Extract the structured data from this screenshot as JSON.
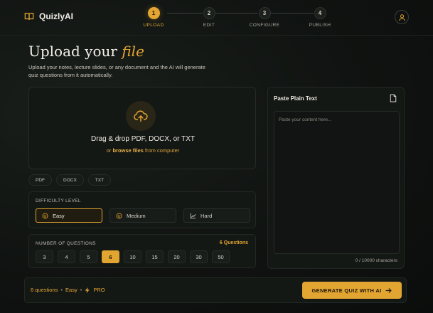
{
  "app": {
    "name": "QuizlyAI"
  },
  "stepper": {
    "steps": [
      {
        "number": "1",
        "label": "UPLOAD"
      },
      {
        "number": "2",
        "label": "EDIT"
      },
      {
        "number": "3",
        "label": "CONFIGURE"
      },
      {
        "number": "4",
        "label": "PUBLISH"
      }
    ],
    "active_index": 0
  },
  "page": {
    "title_prefix": "Upload your",
    "title_highlight": "file",
    "subtitle": "Upload your notes, lecture slides, or any document and the AI will generate quiz questions from it automatically."
  },
  "dropzone": {
    "icon": "cloud-upload-icon",
    "title": "Drag & drop PDF, DOCX, or TXT",
    "sub_prefix": "or",
    "link": "browse files",
    "sub_suffix": "from computer"
  },
  "file_types": [
    "PDF",
    "DOCX",
    "TXT"
  ],
  "difficulty": {
    "label": "DIFFICULTY LEVEL",
    "options": [
      {
        "label": "Easy",
        "icon": "smile-icon"
      },
      {
        "label": "Medium",
        "icon": "smile-icon"
      },
      {
        "label": "Hard",
        "icon": "trend-icon"
      }
    ],
    "selected": "Easy"
  },
  "questions": {
    "label": "NUMBER OF QUESTIONS",
    "count_text": "6 Questions",
    "options": [
      "3",
      "4",
      "5",
      "6",
      "10",
      "15",
      "20",
      "30",
      "50"
    ],
    "selected": "6"
  },
  "paste": {
    "title": "Paste Plain Text",
    "placeholder": "Paste your content here...",
    "value": "",
    "char_count": "0 / 10000 characters"
  },
  "footer": {
    "summary_questions": "6 questions",
    "summary_sep1": "•",
    "summary_difficulty": "Easy",
    "summary_sep2": "•",
    "summary_plan": "PRO",
    "generate_label": "GENERATE QUIZ WITH AI"
  },
  "colors": {
    "accent": "#e3a532",
    "background": "#0b0d0c",
    "panel": "#141815"
  }
}
